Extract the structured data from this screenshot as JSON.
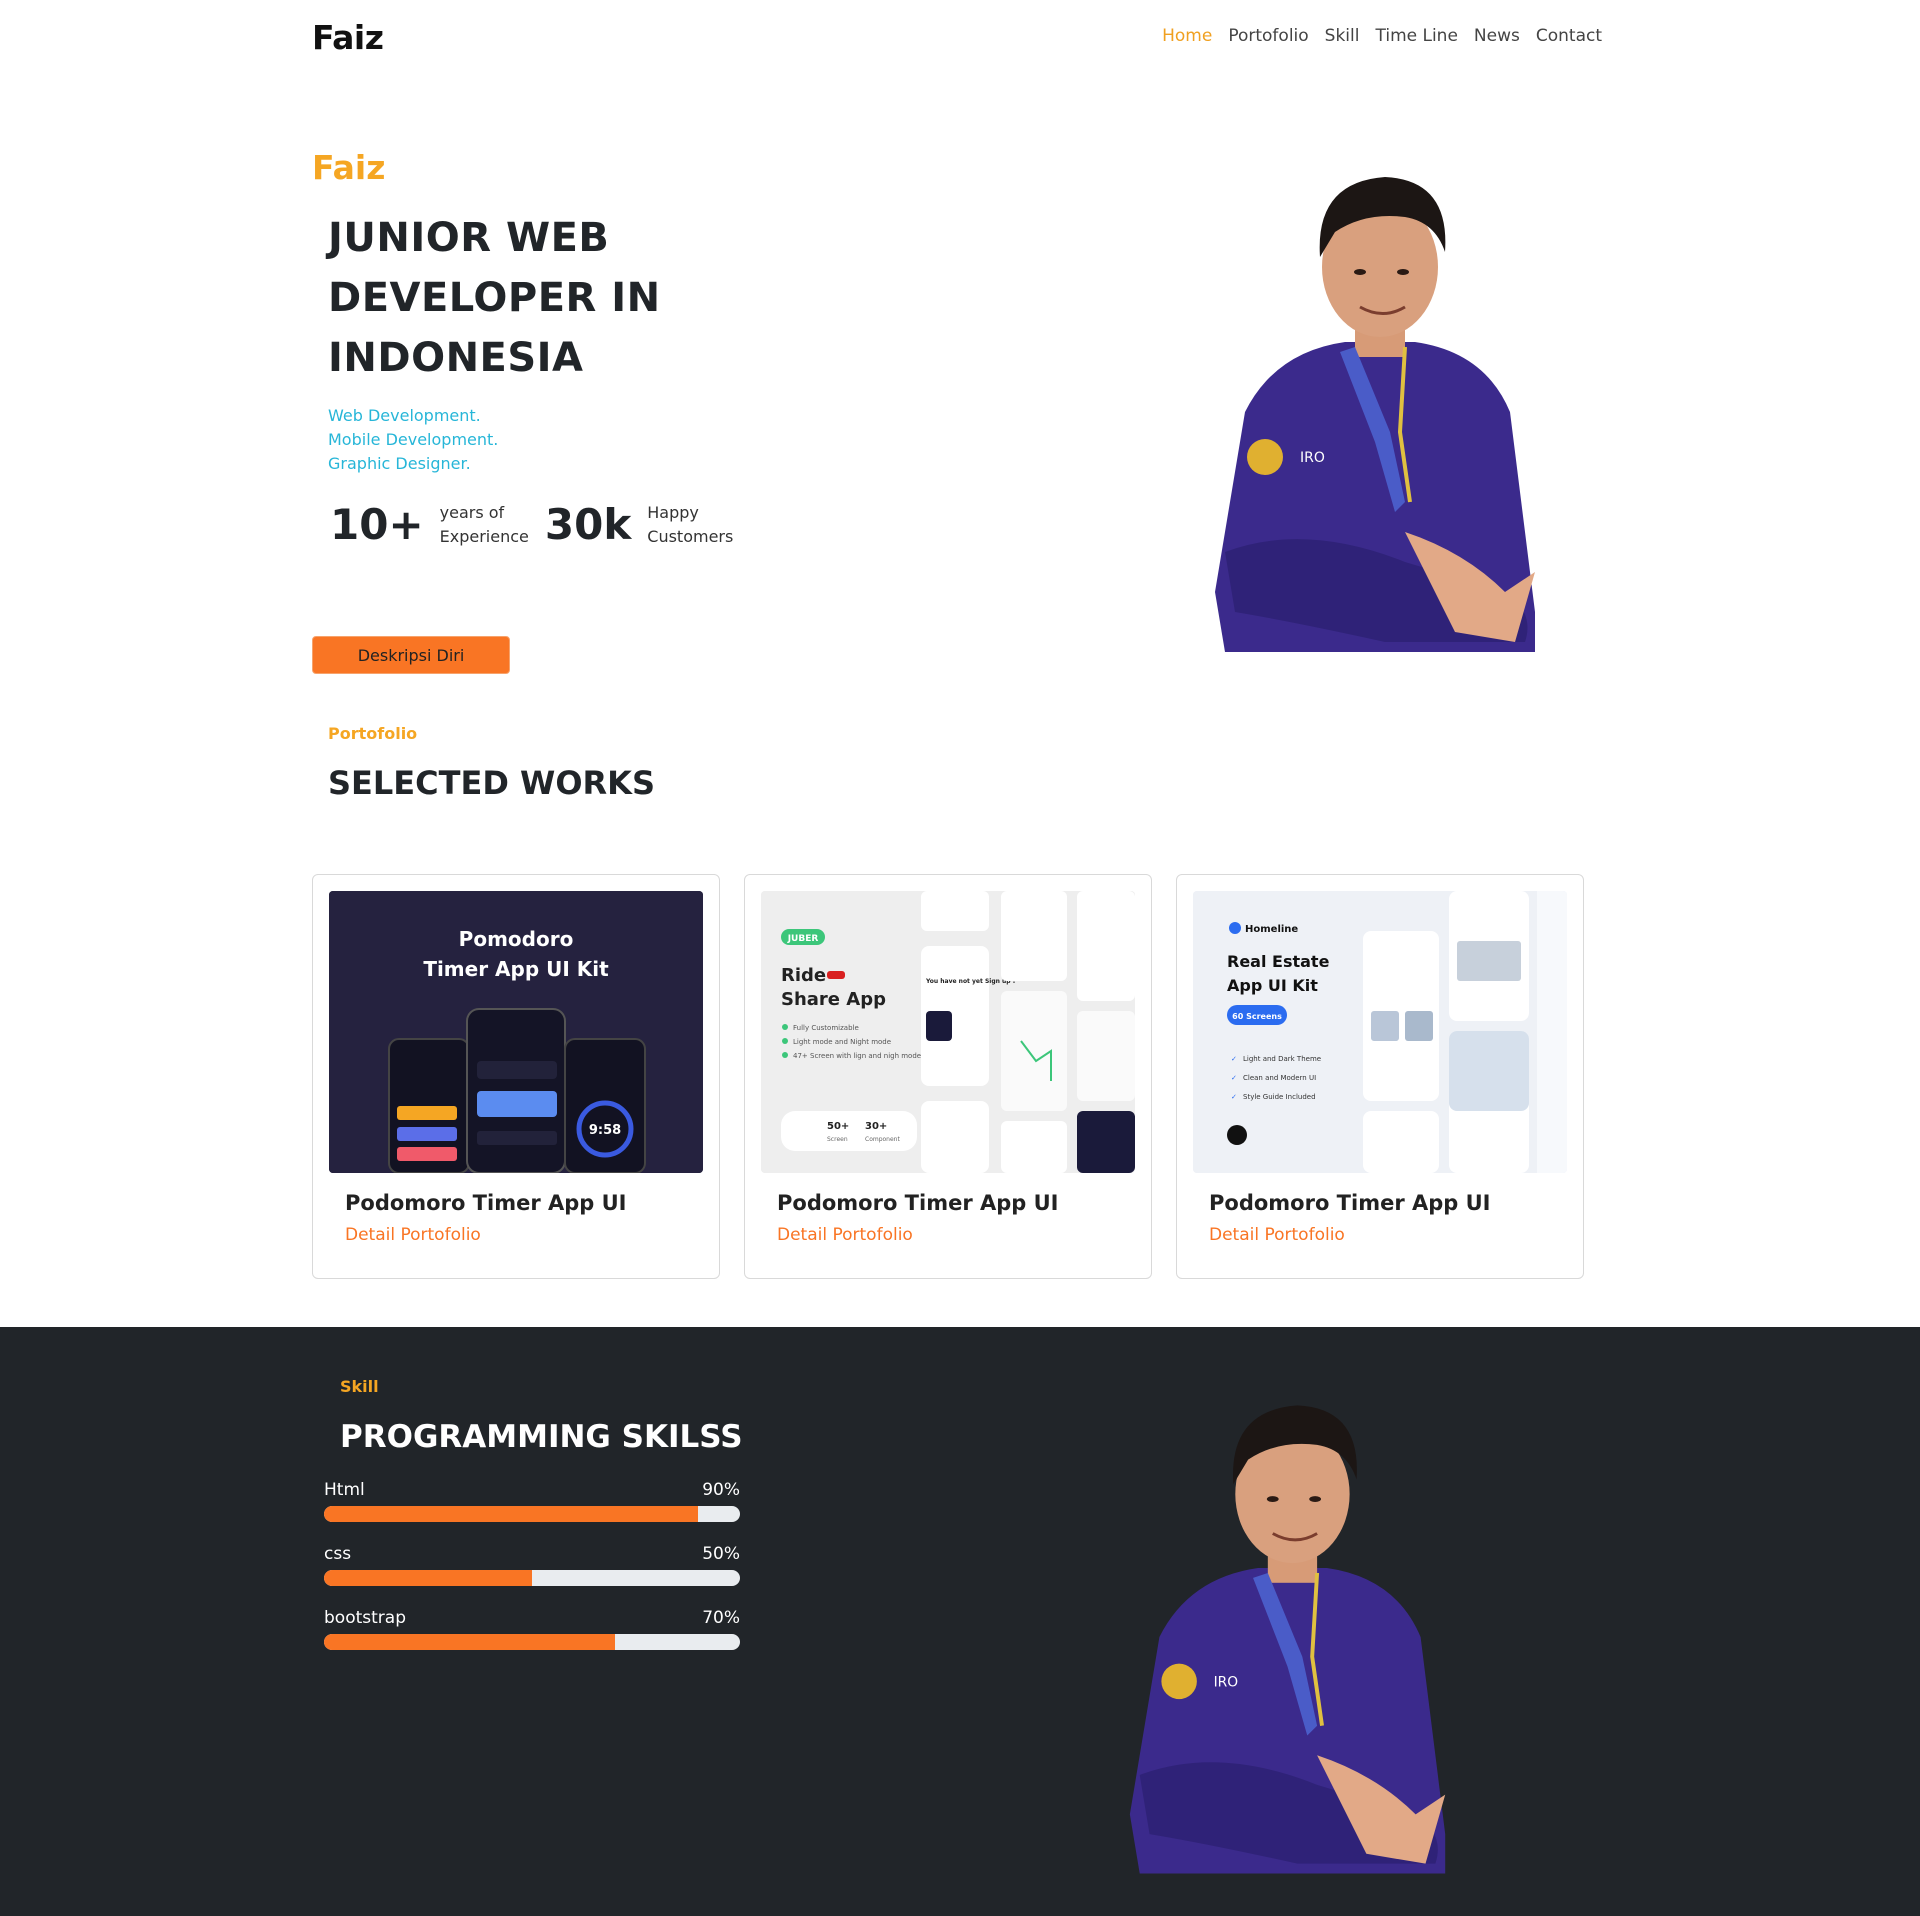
{
  "nav": {
    "brand": "Faiz",
    "links": [
      "Home",
      "Portofolio",
      "Skill",
      "Time Line",
      "News",
      "Contact"
    ],
    "active_link": "Home"
  },
  "hero": {
    "name": "Faiz",
    "title": "JUNIOR WEB DEVELOPER IN INDONESIA",
    "roles": [
      "Web Development.",
      "Mobile Development.",
      "Graphic Designer."
    ],
    "stats": [
      {
        "number": "10+",
        "label_line1": "years of",
        "label_line2": "Experience"
      },
      {
        "number": "30k",
        "label_line1": "Happy",
        "label_line2": "Customers"
      }
    ],
    "button_label": "Deskripsi Diri"
  },
  "portfolio": {
    "label": "Portofolio",
    "title": "SELECTED WORKS",
    "cards": [
      {
        "title": "Podomoro Timer App UI",
        "link": "Detail Portofolio",
        "thumb": {
          "heading_line1": "Pomodoro",
          "heading_line2": "Timer App UI  Kit",
          "timer": "9:58"
        }
      },
      {
        "title": "Podomoro Timer App UI",
        "link": "Detail Portofolio",
        "thumb": {
          "badge": "JUBER",
          "heading_line1": "Ride",
          "heading_line2": "Share App",
          "features": [
            "Fully Customizable",
            "Light mode and Night mode",
            "47+ Screen with lign and nigh mode"
          ],
          "stat1": "50+",
          "stat1_label": "Screen",
          "stat2": "30+",
          "stat2_label": "Component",
          "phone_text": "You have not yet Sign up !"
        }
      },
      {
        "title": "Podomoro Timer App UI",
        "link": "Detail Portofolio",
        "thumb": {
          "brand": "Homeline",
          "heading_line1": "Real Estate",
          "heading_line2": "App UI Kit",
          "pill": "60 Screens",
          "features": [
            "Light and Dark Theme",
            "Clean and Modern UI",
            "Style Guide Included"
          ]
        }
      }
    ]
  },
  "skills": {
    "label": "Skill",
    "title": "PROGRAMMING SKILSS",
    "items": [
      {
        "name": "Html",
        "percent_label": "90%",
        "value": 90
      },
      {
        "name": "css",
        "percent_label": "50%",
        "value": 50
      },
      {
        "name": "bootstrap",
        "percent_label": "70%",
        "value": 70
      }
    ]
  },
  "colors": {
    "accent_orange": "#f97524",
    "label_gold": "#f5a623",
    "role_cyan": "#27b6d8",
    "dark_section": "#212529",
    "shirt_purple": "#3b2a8c"
  }
}
